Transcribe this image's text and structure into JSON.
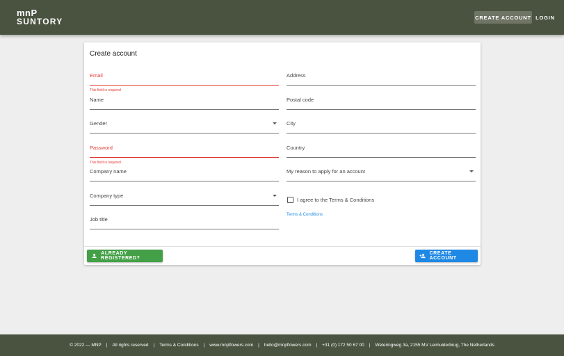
{
  "header": {
    "logo_line1": "mnP",
    "logo_line2": "SUNTORY",
    "create_account": "CREATE ACCOUNT",
    "login": "LOGIN"
  },
  "form": {
    "title": "Create account",
    "email": {
      "label": "Email",
      "error": "This field is required"
    },
    "name": {
      "label": "Name"
    },
    "gender": {
      "label": "Gender"
    },
    "password": {
      "label": "Password",
      "error": "This field is required"
    },
    "company_name": {
      "label": "Company name"
    },
    "company_type": {
      "label": "Company type"
    },
    "job_title": {
      "label": "Job title"
    },
    "address": {
      "label": "Address"
    },
    "postal_code": {
      "label": "Postal code"
    },
    "city": {
      "label": "City"
    },
    "country": {
      "label": "Country"
    },
    "reason": {
      "label": "My reason to apply for an account"
    },
    "terms_checkbox": {
      "label": "I agree to the Terms & Conditions",
      "checked": false
    },
    "terms_link": "Terms & Conditions",
    "already_registered": "ALREADY REGISTERED?",
    "create_account": "CREATE ACCOUNT"
  },
  "footer": {
    "items": [
      "© 2022 — MNP",
      "All rights reserved",
      "Terms & Conditions",
      "www.mnpflowers.com",
      "hello@mnpflowers.com",
      "+31 (0) 172 50 67 00",
      "Weteringweg 3a, 2155 MV Leimuiderbrug, The Netherlands"
    ]
  },
  "colors": {
    "header_bg": "#4a5340",
    "error": "#e53935",
    "primary": "#1e88e5",
    "success": "#43a047"
  }
}
